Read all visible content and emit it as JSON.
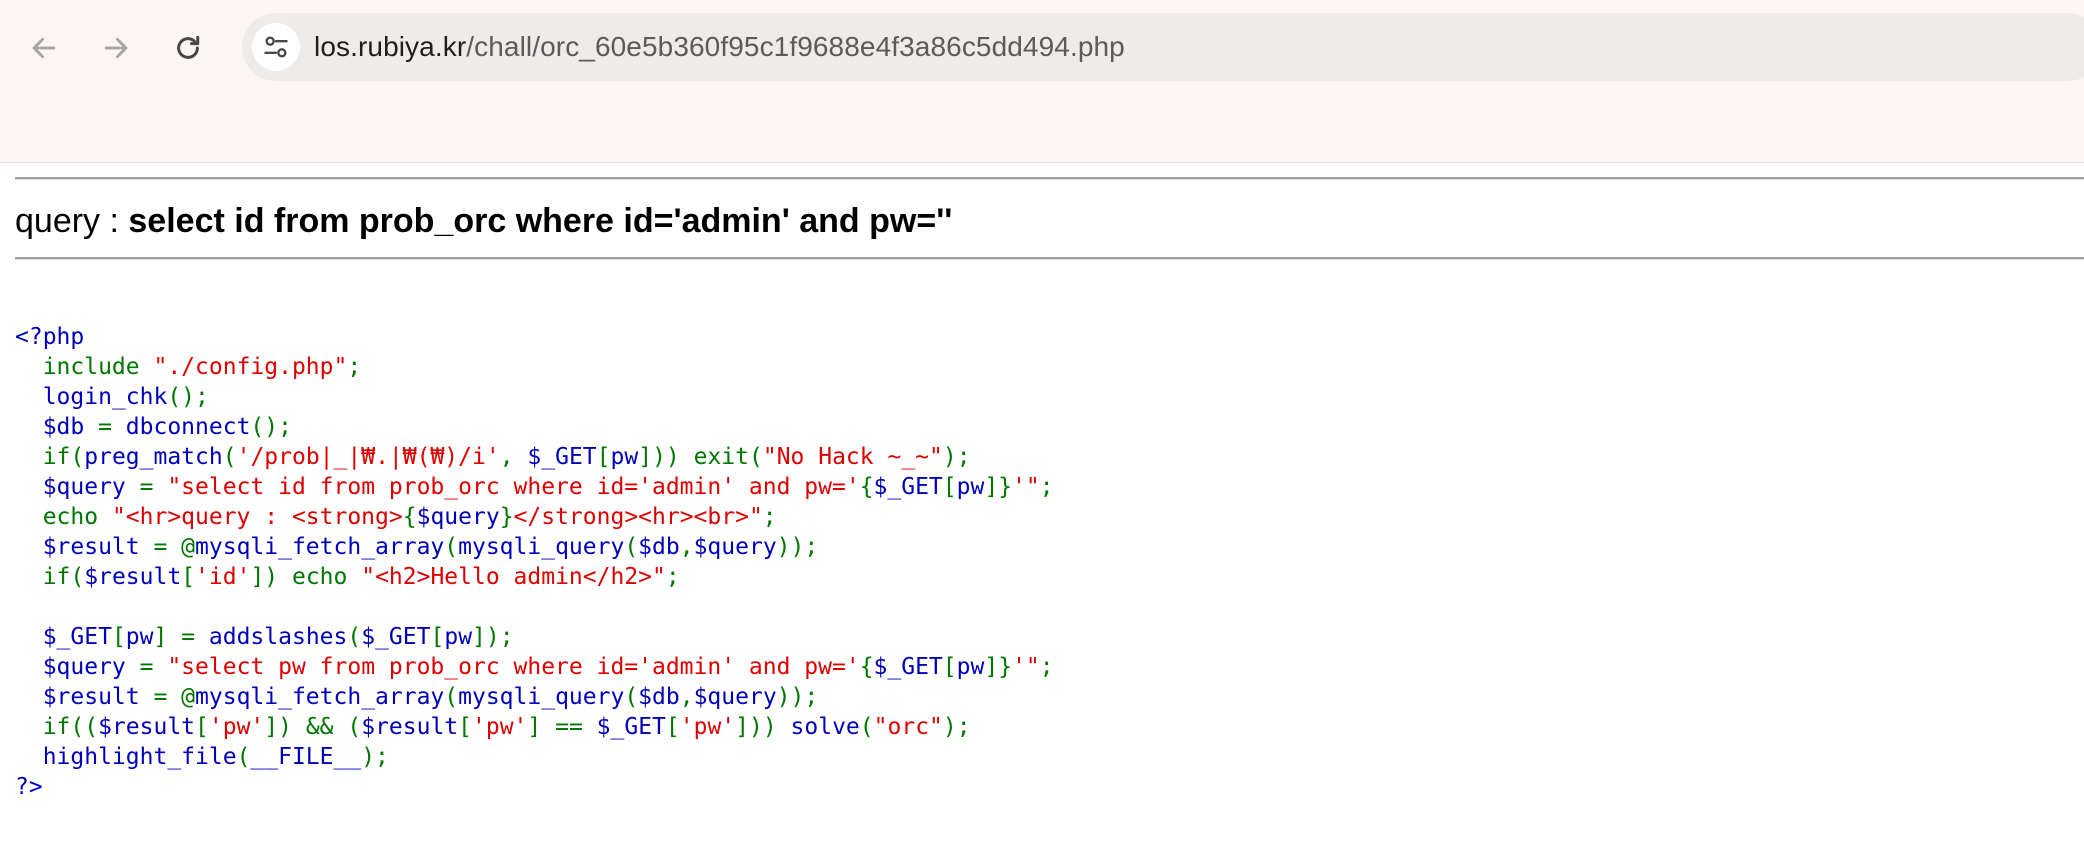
{
  "browser": {
    "back_icon": "arrow-left-icon",
    "forward_icon": "arrow-right-icon",
    "reload_icon": "reload-icon",
    "site_info_icon": "tune-icon",
    "url_host": "los.rubiya.kr",
    "url_path": "/chall/orc_60e5b360f95c1f9688e4f3a86c5dd494.php"
  },
  "page": {
    "query_label": "query : ",
    "query_text": "select id from prob_orc where id='admin' and pw=''"
  },
  "colors": {
    "default": "#0000BB",
    "keyword": "#007700",
    "string": "#DD0000"
  },
  "source": {
    "l01": [
      "<?php"
    ],
    "l02": [
      "  include ",
      "\"./config.php\"",
      ";"
    ],
    "l03": [
      "  login_chk",
      "();"
    ],
    "l04": [
      "  $db ",
      "= ",
      "dbconnect",
      "();"
    ],
    "l05": [
      "  if(",
      "preg_match",
      "(",
      "'/prob|_|₩.|₩(₩)/i'",
      ", ",
      "$_GET",
      "[",
      "pw",
      "])) exit(",
      "\"No Hack ~_~\"",
      ");"
    ],
    "l06": [
      "  $query ",
      "= ",
      "\"select id from prob_orc where id='admin' and pw='",
      "{",
      "$_GET",
      "[",
      "pw",
      "]",
      "}",
      "'\"",
      ";"
    ],
    "l07": [
      "  echo ",
      "\"<hr>query : <strong>",
      "{",
      "$query",
      "}",
      "</strong><hr><br>\"",
      ";"
    ],
    "l08": [
      "  $result ",
      "= @",
      "mysqli_fetch_array",
      "(",
      "mysqli_query",
      "(",
      "$db",
      ",",
      "$query",
      "));"
    ],
    "l09": [
      "  if(",
      "$result",
      "[",
      "'id'",
      "]) echo ",
      "\"<h2>Hello admin</h2>\"",
      ";"
    ],
    "l10": [
      ""
    ],
    "l11": [
      "  $_GET",
      "[",
      "pw",
      "] = ",
      "addslashes",
      "(",
      "$_GET",
      "[",
      "pw",
      "]);"
    ],
    "l12": [
      "  $query ",
      "= ",
      "\"select pw from prob_orc where id='admin' and pw='",
      "{",
      "$_GET",
      "[",
      "pw",
      "]",
      "}",
      "'\"",
      ";"
    ],
    "l13": [
      "  $result ",
      "= @",
      "mysqli_fetch_array",
      "(",
      "mysqli_query",
      "(",
      "$db",
      ",",
      "$query",
      "));"
    ],
    "l14": [
      "  if((",
      "$result",
      "[",
      "'pw'",
      "]) && (",
      "$result",
      "[",
      "'pw'",
      "] == ",
      "$_GET",
      "[",
      "'pw'",
      "])) ",
      "solve",
      "(",
      "\"orc\"",
      ");"
    ],
    "l15": [
      "  highlight_file",
      "(",
      "__FILE__",
      ");"
    ],
    "l16": [
      "?>"
    ]
  }
}
